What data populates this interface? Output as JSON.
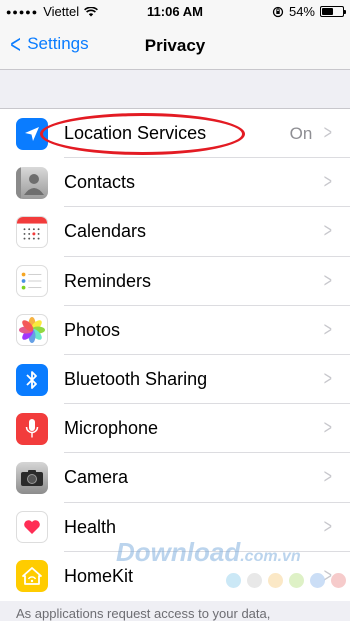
{
  "status_bar": {
    "carrier": "Viettel",
    "time": "11:06 AM",
    "battery": "54%",
    "battery_level": 0.54
  },
  "nav": {
    "back_label": "Settings",
    "title": "Privacy"
  },
  "rows": [
    {
      "label": "Location Services",
      "value": "On",
      "icon": "location-arrow-icon"
    },
    {
      "label": "Contacts",
      "value": "",
      "icon": "contacts-icon"
    },
    {
      "label": "Calendars",
      "value": "",
      "icon": "calendar-icon"
    },
    {
      "label": "Reminders",
      "value": "",
      "icon": "reminders-icon"
    },
    {
      "label": "Photos",
      "value": "",
      "icon": "photos-icon"
    },
    {
      "label": "Bluetooth Sharing",
      "value": "",
      "icon": "bluetooth-icon"
    },
    {
      "label": "Microphone",
      "value": "",
      "icon": "microphone-icon"
    },
    {
      "label": "Camera",
      "value": "",
      "icon": "camera-icon"
    },
    {
      "label": "Health",
      "value": "",
      "icon": "heart-icon"
    },
    {
      "label": "HomeKit",
      "value": "",
      "icon": "home-icon"
    }
  ],
  "footer_note": "As applications request access to your data,",
  "watermark": {
    "main": "Download",
    "suffix": ".com.vn"
  },
  "colors": {
    "accent": "#0a7cff",
    "highlight": "#e31b23"
  }
}
